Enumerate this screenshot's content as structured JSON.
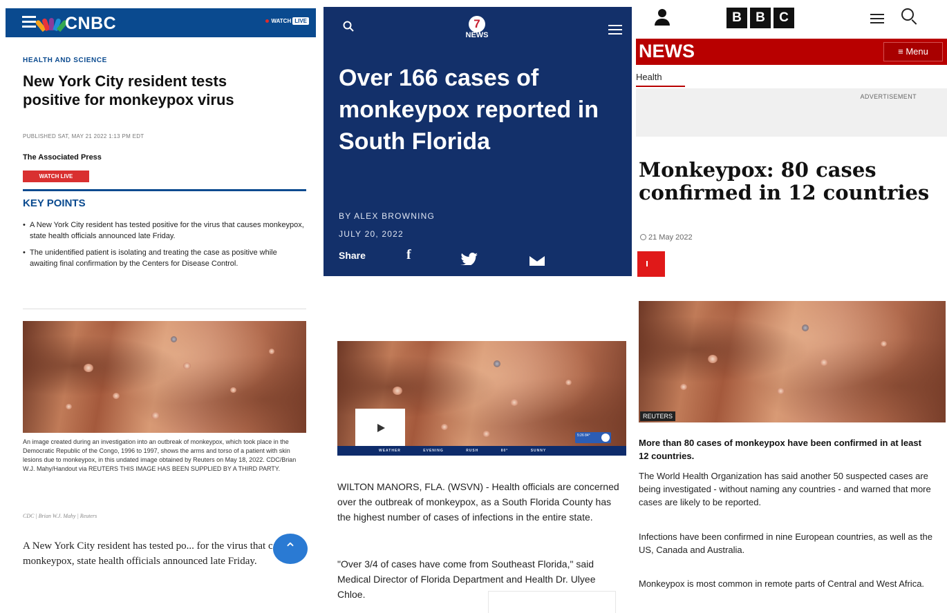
{
  "cnbc": {
    "logo_text": "CNBC",
    "watch_label": "WATCH",
    "live_badge": "LIVE",
    "kicker": "HEALTH AND SCIENCE",
    "title": "New York City resident tests positive for monkeypox virus",
    "published": "PUBLISHED SAT, MAY 21 2022 1:13 PM EDT",
    "author": "The Associated Press",
    "watch_live_button": "WATCH LIVE",
    "key_points_heading": "KEY POINTS",
    "key_points": [
      "A New York City resident has tested positive for the virus that causes monkeypox, state health officials announced late Friday.",
      "The unidentified patient is isolating and treating the case as positive while awaiting final confirmation by the Centers for Disease Control."
    ],
    "caption": "An image created during an investigation into an outbreak of monkeypox, which took place in the Democratic Republic of the Congo, 1996 to 1997, shows the arms and torso of a patient with skin lesions due to monkeypox, in this undated image obtained by Reuters on May 18, 2022. CDC/Brian W.J. Mahy/Handout via REUTERS THIS IMAGE HAS BEEN SUPPLIED BY A THIRD PARTY.",
    "credit": "CDC | Brian W.J. Mahy | Reuters",
    "body": "A New York City resident has tested po... for the virus that causes monkeypox, state health officials announced late Friday.",
    "icons": {
      "menu": "hamburger-menu-icon",
      "logo": "peacock-logo-icon",
      "scroll": "chevron-up-icon"
    },
    "colors": {
      "brand": "#0a4a8f",
      "live": "#d93030"
    }
  },
  "wsvn": {
    "logo_number": "7",
    "logo_text": "NEWS",
    "title": "Over 166 cases of monkeypox reported in South Florida",
    "byline": "BY ALEX BROWNING",
    "date": "JULY 20, 2022",
    "share_label": "Share",
    "share_fb": "f",
    "ticker": "WEATHER EVENING RUSH 80° SUNNY",
    "bug_time": "5:26 84°",
    "paragraphs": [
      "WILTON MANORS, FLA. (WSVN) - Health officials are concerned over the outbreak of monkeypox, as a South Florida County has the highest number of cases of infections in the entire state.",
      "\"Over 3/4 of cases have come from Southeast Florida,\" said Medical Director of Florida Department and Health Dr. Ulyee Chloe."
    ],
    "icons": {
      "search": "search-icon",
      "menu": "hamburger-menu-icon",
      "play": "play-icon",
      "facebook": "facebook-icon",
      "twitter": "twitter-icon",
      "mail": "mail-icon"
    },
    "colors": {
      "brand": "#13306a"
    }
  },
  "bbc": {
    "logo_letters": [
      "B",
      "B",
      "C"
    ],
    "news_label": "NEWS",
    "menu_label": "≡ Menu",
    "section": "Health",
    "ad_label": "ADVERTISEMENT",
    "title": "Monkeypox: 80 cases confirmed in 12 countries",
    "date": "21 May 2022",
    "share_glyph": "<",
    "photo_credit": "REUTERS",
    "lead": "More than 80 cases of monkeypox have been confirmed in at least 12 countries.",
    "paragraphs": [
      "The World Health Organization has said another 50 suspected cases are being investigated - without naming any countries - and warned that more cases are likely to be reported.",
      "Infections have been confirmed in nine European countries, as well as the US, Canada and Australia.",
      "Monkeypox is most common in remote parts of Central and West Africa."
    ],
    "icons": {
      "account": "user-icon",
      "menu": "hamburger-menu-icon",
      "search": "search-icon",
      "share": "share-icon",
      "clock": "clock-icon"
    },
    "colors": {
      "brand": "#b80000"
    }
  }
}
